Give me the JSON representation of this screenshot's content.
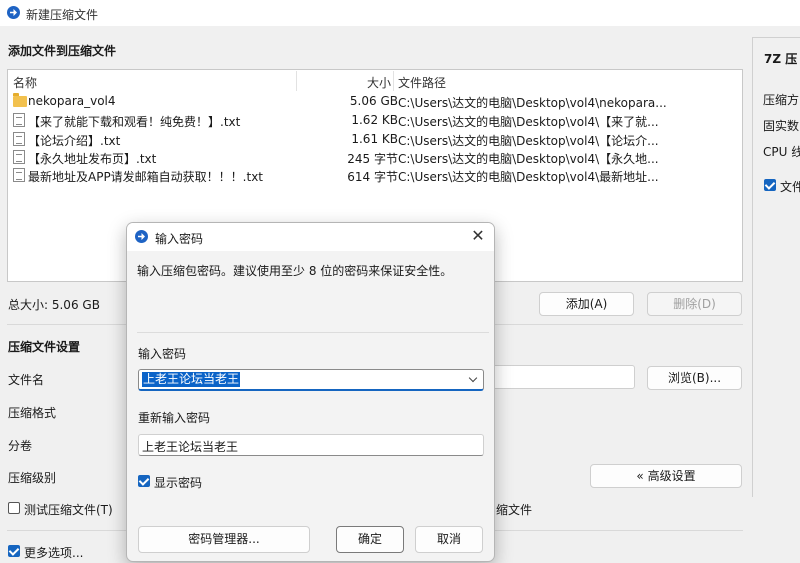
{
  "window": {
    "title": "新建压缩文件"
  },
  "main": {
    "add_section_title": "添加文件到压缩文件",
    "columns": {
      "name": "名称",
      "size": "大小",
      "path": "文件路径"
    },
    "files": [
      {
        "icon": "folder-icon",
        "name": "nekopara_vol4",
        "size": "5.06 GB",
        "path": "C:\\Users\\达文的电脑\\Desktop\\vol4\\nekopara..."
      },
      {
        "icon": "text-file-icon",
        "name": "【来了就能下载和观看！纯免费！】.txt",
        "size": "1.62 KB",
        "path": "C:\\Users\\达文的电脑\\Desktop\\vol4\\【来了就..."
      },
      {
        "icon": "text-file-icon",
        "name": "【论坛介绍】.txt",
        "size": "1.61 KB",
        "path": "C:\\Users\\达文的电脑\\Desktop\\vol4\\【论坛介..."
      },
      {
        "icon": "text-file-icon",
        "name": "【永久地址发布页】.txt",
        "size": "245 字节",
        "path": "C:\\Users\\达文的电脑\\Desktop\\vol4\\【永久地..."
      },
      {
        "icon": "text-file-icon",
        "name": "最新地址及APP请发邮箱自动获取！！！.txt",
        "size": "614 字节",
        "path": "C:\\Users\\达文的电脑\\Desktop\\vol4\\最新地址..."
      }
    ],
    "total_size": "总大小: 5.06 GB",
    "add_button": "添加(A)",
    "delete_button": "删除(D)",
    "settings_title": "压缩文件设置",
    "filename_label": "文件名",
    "format_label": "压缩格式",
    "split_label": "分卷",
    "level_label": "压缩级别",
    "browse_button": "浏览(B)...",
    "advanced_button": "« 高级设置",
    "test_checkbox": "测试压缩文件(T)",
    "partial_right_text": "缩文件",
    "more_options": "更多选项..."
  },
  "right_panel": {
    "title": "7Z 压",
    "line1": "压缩方",
    "line2": "固实数",
    "line3": "CPU 线",
    "checkbox": "文件"
  },
  "dialog": {
    "title": "输入密码",
    "description": "输入压缩包密码。建议使用至少 8 位的密码来保证安全性。",
    "password_label": "输入密码",
    "password_value": "上老王论坛当老王",
    "reenter_label": "重新输入密码",
    "reenter_value": "上老王论坛当老王",
    "show_password": "显示密码",
    "manager_button": "密码管理器...",
    "ok_button": "确定",
    "cancel_button": "取消"
  },
  "colors": {
    "accent": "#1565c0",
    "selection": "#0b63c8"
  }
}
